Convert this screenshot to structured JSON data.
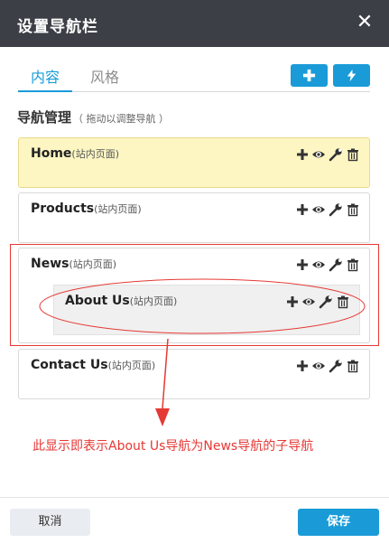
{
  "dialog": {
    "title": "设置导航栏",
    "close_glyph": "✕"
  },
  "tabs": [
    {
      "label": "内容",
      "active": true
    },
    {
      "label": "风格",
      "active": false
    }
  ],
  "toolbar": {
    "add_icon": "plus-icon",
    "quick_icon": "lightning-icon"
  },
  "section": {
    "title": "导航管理",
    "hint": "（ 拖动以调整导航 ）"
  },
  "nav_items": [
    {
      "name": "Home",
      "type": "(站内页面)",
      "highlighted": true,
      "children": []
    },
    {
      "name": "Products",
      "type": "(站内页面)",
      "highlighted": false,
      "children": []
    },
    {
      "name": "News",
      "type": "(站内页面)",
      "highlighted": false,
      "children": [
        {
          "name": "About Us",
          "type": "(站内页面)"
        }
      ]
    },
    {
      "name": "Contact Us",
      "type": "(站内页面)",
      "highlighted": false,
      "children": []
    }
  ],
  "item_actions": [
    "plus-icon",
    "eye-icon",
    "wrench-icon",
    "trash-icon"
  ],
  "annotation": {
    "text": "此显示即表示About Us导航为News导航的子导航",
    "color": "#e53935"
  },
  "footer": {
    "cancel_label": "取消",
    "save_label": "保存"
  },
  "colors": {
    "header_bg": "#3c3f45",
    "accent": "#1a9bd8",
    "highlight_bg": "#fdf6c3",
    "annotation": "#e53935"
  }
}
